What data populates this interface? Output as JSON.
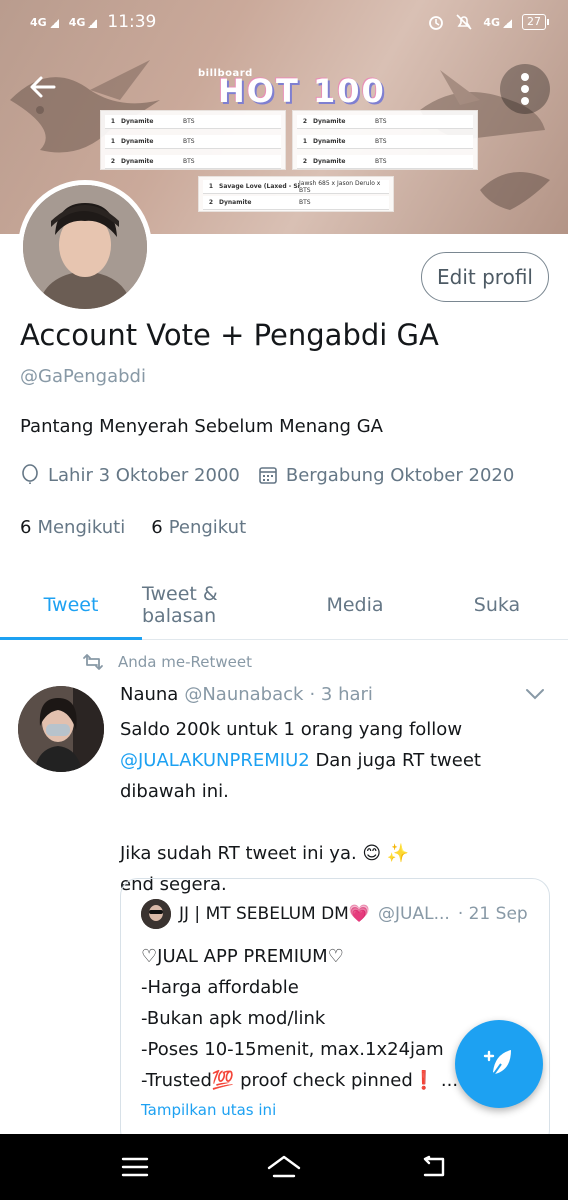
{
  "status_bar": {
    "network_1": "4G",
    "network_2": "4G",
    "time": "11:39",
    "network_right": "4G",
    "battery": "27",
    "icons": [
      "alarm-icon",
      "mute-icon",
      "signal-icon",
      "battery-icon"
    ]
  },
  "banner": {
    "brand": "billboard",
    "headline": "HOT 100",
    "chart_rows": [
      {
        "rank": "1",
        "title": "Dynamite",
        "artist": "BTS"
      },
      {
        "rank": "1",
        "title": "Dynamite",
        "artist": "BTS"
      },
      {
        "rank": "2",
        "title": "Dynamite",
        "artist": "BTS"
      },
      {
        "rank": "2",
        "title": "Dynamite",
        "artist": "BTS"
      },
      {
        "rank": "1",
        "title": "Dynamite",
        "artist": "BTS"
      },
      {
        "rank": "2",
        "title": "Dynamite",
        "artist": "BTS"
      },
      {
        "rank": "1",
        "title": "Savage Love (Laxed - Siren Beat)",
        "artist": "Jawsh 685 x Jason Derulo x BTS"
      },
      {
        "rank": "2",
        "title": "Dynamite",
        "artist": "BTS"
      }
    ]
  },
  "profile": {
    "edit_label": "Edit profil",
    "display_name": "Account Vote + Pengabdi GA",
    "handle": "@GaPengabdi",
    "bio": "Pantang Menyerah Sebelum Menang GA",
    "birth": "Lahir 3 Oktober 2000",
    "joined": "Bergabung Oktober 2020",
    "following_count": "6",
    "following_label": "Mengikuti",
    "followers_count": "6",
    "followers_label": "Pengikut"
  },
  "tabs": [
    {
      "label": "Tweet",
      "active": true
    },
    {
      "label": "Tweet & balasan",
      "active": false
    },
    {
      "label": "Media",
      "active": false
    },
    {
      "label": "Suka",
      "active": false
    }
  ],
  "tweet": {
    "retweet_note": "Anda me-Retweet",
    "author_name": "Nauna",
    "author_handle": "@Naunaback",
    "time": "· 3 hari",
    "line1": "Saldo 200k untuk 1 orang yang follow",
    "mention": "@JUALAKUNPREMIU2",
    "line2_rest": " Dan juga RT tweet dibawah ini.",
    "line3": "Jika sudah RT tweet ini ya. 😊 ✨",
    "line4": "end segera.",
    "quote": {
      "author_name": "JJ | MT SEBELUM DM💗",
      "author_handle": "@JUAL...",
      "time": "· 21 Sep",
      "lines": [
        "♡JUAL APP PREMIUM♡",
        "-Harga affordable",
        "-Bukan apk mod/link",
        "-Poses 10-15menit, max.1x24jam",
        "-Trusted💯 proof check pinned❗ ..."
      ],
      "show_thread": "Tampilkan utas ini"
    }
  },
  "colors": {
    "accent": "#1da1f2",
    "muted": "#657786",
    "text": "#14171a"
  }
}
